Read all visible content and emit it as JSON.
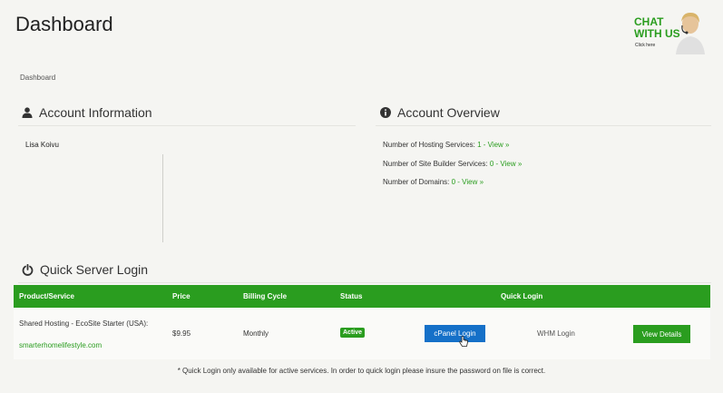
{
  "page": {
    "title": "Dashboard",
    "breadcrumb": "Dashboard"
  },
  "chat": {
    "line1": "CHAT",
    "line2": "WITH US",
    "sub": "Click here"
  },
  "account_info": {
    "heading": "Account Information",
    "name": "Lisa Koivu"
  },
  "account_overview": {
    "heading": "Account Overview",
    "items": [
      {
        "label": "Number of Hosting Services:",
        "count": "1",
        "link": "- View »"
      },
      {
        "label": "Number of Site Builder Services:",
        "count": "0",
        "link": "- View »"
      },
      {
        "label": "Number of Domains:",
        "count": "0",
        "link": "- View »"
      }
    ]
  },
  "quick_login": {
    "heading": "Quick Server Login",
    "columns": [
      "Product/Service",
      "Price",
      "Billing Cycle",
      "Status",
      "Quick Login"
    ],
    "row": {
      "product": "Shared Hosting - EcoSite Starter (USA):",
      "domain": "smarterhomelifestyle.com",
      "price": "$9.95",
      "cycle": "Monthly",
      "status": "Active",
      "cpanel_label": "cPanel Login",
      "whm_label": "WHM Login",
      "details_label": "View Details"
    },
    "footnote": "* Quick Login only available for active services. In order to quick login please insure the password on file is correct."
  },
  "colors": {
    "accent_green": "#2a9d1f",
    "button_blue": "#1570c8"
  }
}
